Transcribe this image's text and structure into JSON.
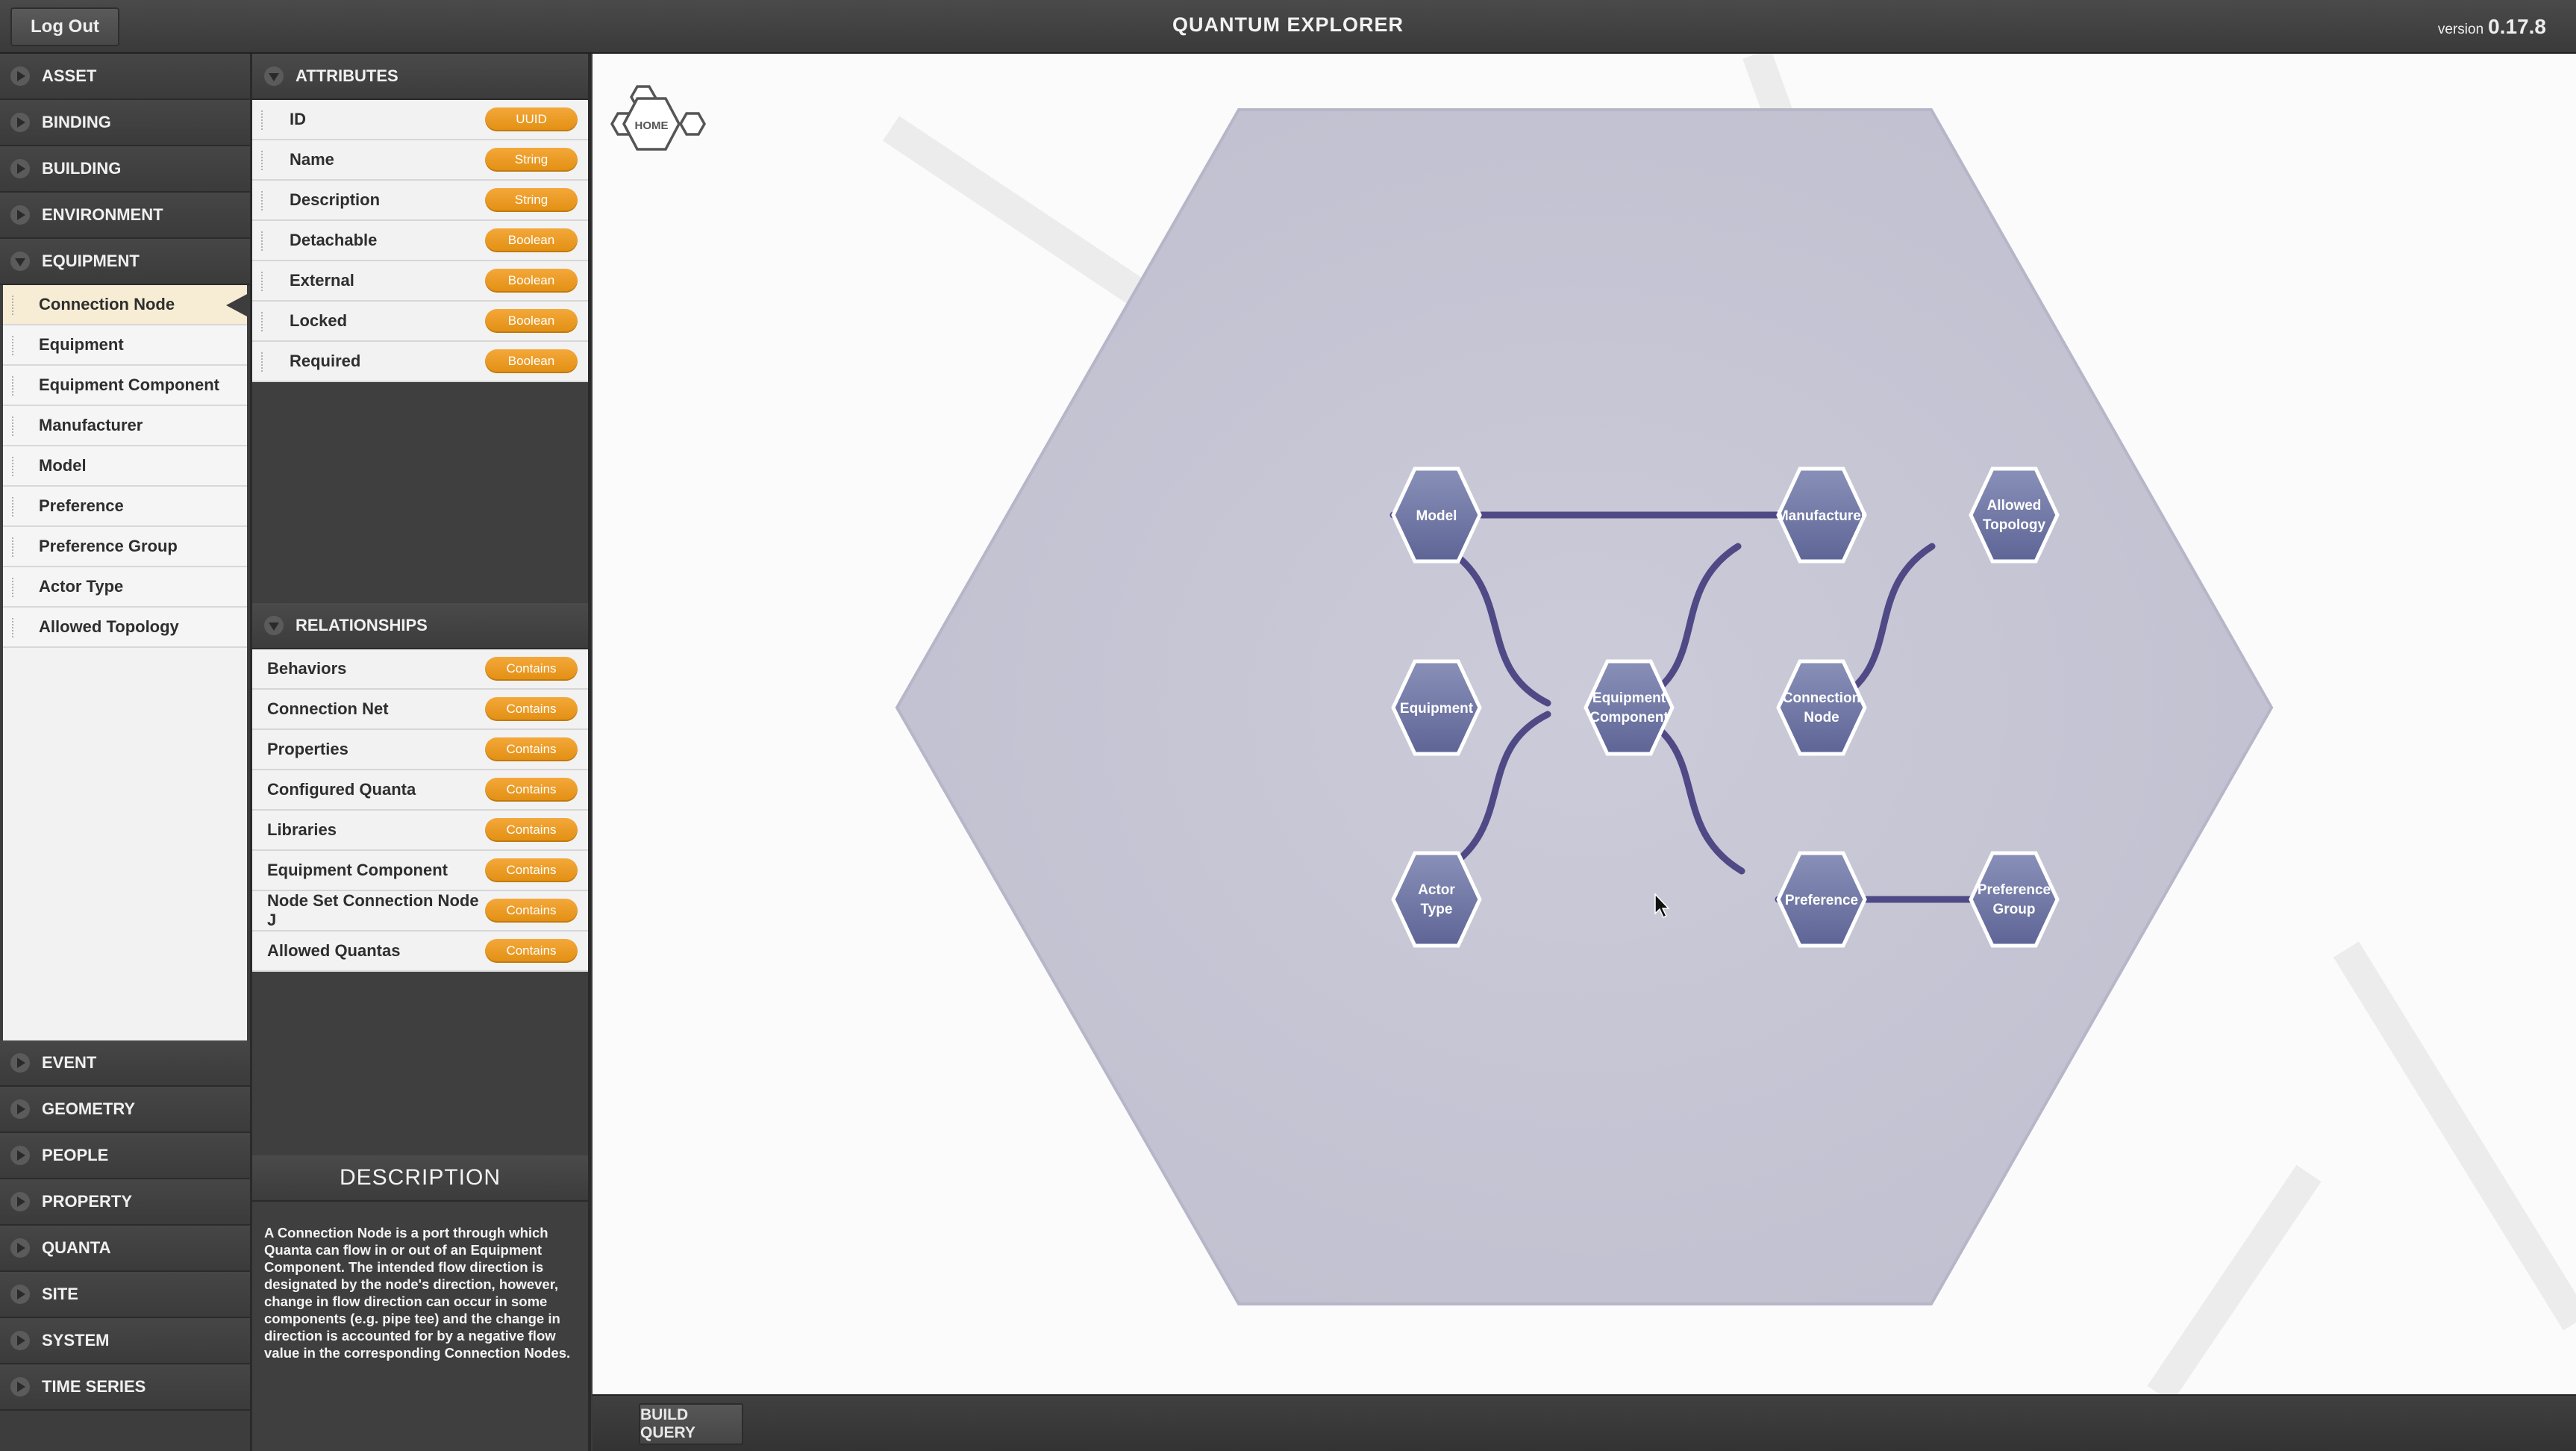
{
  "header": {
    "logout_label": "Log Out",
    "title": "QUANTUM EXPLORER",
    "version_prefix": "version",
    "version_number": "0.17.8"
  },
  "categories_top": [
    {
      "label": "ASSET"
    },
    {
      "label": "BINDING"
    },
    {
      "label": "BUILDING"
    },
    {
      "label": "ENVIRONMENT"
    },
    {
      "label": "EQUIPMENT"
    }
  ],
  "equipment_items": [
    {
      "label": "Connection Node"
    },
    {
      "label": "Equipment"
    },
    {
      "label": "Equipment Component"
    },
    {
      "label": "Manufacturer"
    },
    {
      "label": "Model"
    },
    {
      "label": "Preference"
    },
    {
      "label": "Preference Group"
    },
    {
      "label": "Actor Type"
    },
    {
      "label": "Allowed Topology"
    }
  ],
  "categories_bottom": [
    {
      "label": "EVENT"
    },
    {
      "label": "GEOMETRY"
    },
    {
      "label": "PEOPLE"
    },
    {
      "label": "PROPERTY"
    },
    {
      "label": "QUANTA"
    },
    {
      "label": "SITE"
    },
    {
      "label": "SYSTEM"
    },
    {
      "label": "TIME SERIES"
    }
  ],
  "attributes": {
    "heading": "ATTRIBUTES",
    "rows": [
      {
        "name": "ID",
        "type": "UUID"
      },
      {
        "name": "Name",
        "type": "String"
      },
      {
        "name": "Description",
        "type": "String"
      },
      {
        "name": "Detachable",
        "type": "Boolean"
      },
      {
        "name": "External",
        "type": "Boolean"
      },
      {
        "name": "Locked",
        "type": "Boolean"
      },
      {
        "name": "Required",
        "type": "Boolean"
      }
    ]
  },
  "relationships": {
    "heading": "RELATIONSHIPS",
    "rows": [
      {
        "name": "Behaviors",
        "type": "Contains"
      },
      {
        "name": "Connection Net",
        "type": "Contains"
      },
      {
        "name": "Properties",
        "type": "Contains"
      },
      {
        "name": "Configured Quanta",
        "type": "Contains"
      },
      {
        "name": "Libraries",
        "type": "Contains"
      },
      {
        "name": "Equipment Component",
        "type": "Contains"
      },
      {
        "name": "Node Set Connection Node J",
        "type": "Contains"
      },
      {
        "name": "Allowed Quantas",
        "type": "Contains"
      }
    ]
  },
  "description": {
    "heading": "DESCRIPTION",
    "text": "A Connection Node is a port through which Quanta can flow in or out of an Equipment Component. The intended flow direction is designated by the node's direction, however, change in flow direction can occur in some components (e.g. pipe tee) and the change in direction is accounted for by a negative flow value in the corresponding Connection Nodes."
  },
  "canvas": {
    "home_label": "HOME",
    "nodes": {
      "model": [
        "Model"
      ],
      "manufacturer": [
        "Manufacturer"
      ],
      "allowed_topology": [
        "Allowed",
        "Topology"
      ],
      "equipment": [
        "Equipment"
      ],
      "equipment_component": [
        "Equipment",
        "Component"
      ],
      "connection_node": [
        "Connection",
        "Node"
      ],
      "actor_type": [
        "Actor",
        "Type"
      ],
      "preference": [
        "Preference"
      ],
      "preference_group": [
        "Preference",
        "Group"
      ]
    }
  },
  "footer": {
    "build_query_label": "BUILD QUERY"
  },
  "colors": {
    "badge": "#e99a1e",
    "node_fill": "#7d84ad",
    "edge": "#4f4a86",
    "panel_dark": "#3d3d3d",
    "selected_item": "#f7ecd4"
  }
}
